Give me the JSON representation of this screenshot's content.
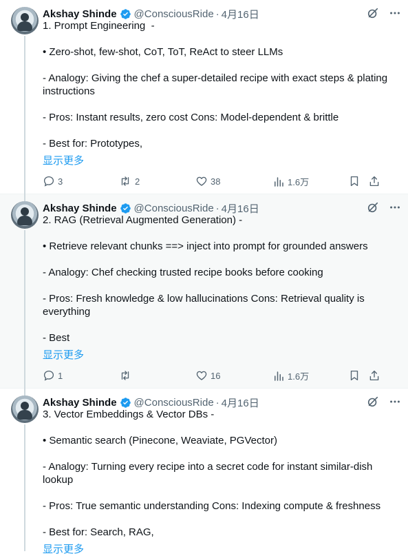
{
  "tweets": [
    {
      "author": "Akshay Shinde",
      "handle": "@ConsciousRide",
      "separator": "·",
      "date": "4月16日",
      "text": "1. Prompt Engineering  -\n\n• Zero-shot, few-shot, CoT, ToT, ReAct to steer LLMs\n\n- Analogy: Giving the chef a super-detailed recipe with exact steps & plating instructions\n\n- Pros: Instant results, zero cost Cons: Model-dependent & brittle\n\n- Best for: Prototypes,",
      "show_more": "显示更多",
      "replies": "3",
      "reposts": "2",
      "likes": "38",
      "views": "1.6万"
    },
    {
      "author": "Akshay Shinde",
      "handle": "@ConsciousRide",
      "separator": "·",
      "date": "4月16日",
      "text": "2. RAG (Retrieval Augmented Generation) -\n\n• Retrieve relevant chunks ==> inject into prompt for grounded answers\n\n- Analogy: Chef checking trusted recipe books before cooking\n\n- Pros: Fresh knowledge & low hallucinations Cons: Retrieval quality is everything\n\n- Best",
      "show_more": "显示更多",
      "replies": "1",
      "reposts": "",
      "likes": "16",
      "views": "1.6万"
    },
    {
      "author": "Akshay Shinde",
      "handle": "@ConsciousRide",
      "separator": "·",
      "date": "4月16日",
      "text": "3. Vector Embeddings & Vector DBs -\n\n• Semantic search (Pinecone, Weaviate, PGVector)\n\n- Analogy: Turning every recipe into a secret code for instant similar-dish lookup\n\n- Pros: True semantic understanding Cons: Indexing compute & freshness\n\n- Best for: Search, RAG,",
      "show_more": "显示更多"
    }
  ],
  "icons": {
    "verified": "verified-badge-icon",
    "grok": "grok-icon",
    "more": "more-dots-icon",
    "reply": "reply-icon",
    "repost": "repost-icon",
    "like": "like-icon",
    "views": "views-icon",
    "bookmark": "bookmark-icon",
    "share": "share-icon"
  },
  "colors": {
    "link": "#1d9bf0",
    "muted": "#536471",
    "text": "#0f1419",
    "verified": "#1d9bf0"
  }
}
